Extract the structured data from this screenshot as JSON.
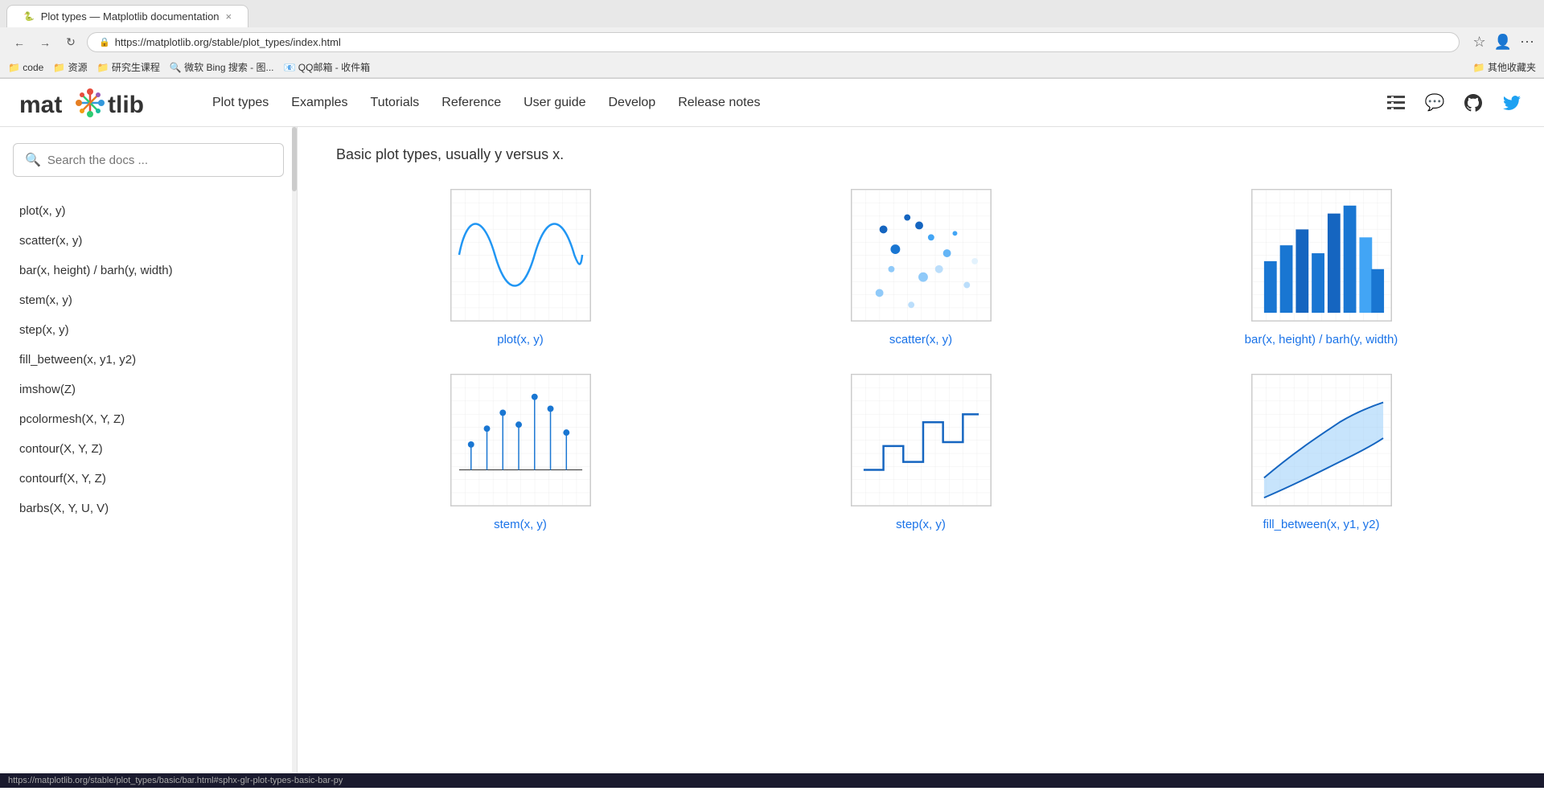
{
  "browser": {
    "url": "https://matplotlib.org/stable/plot_types/index.html",
    "bookmarks": [
      "code",
      "资源",
      "研究生课程",
      "微软 Bing 搜索 - 图...",
      "QQ邮箱 - 收件箱",
      "其他收藏夹"
    ]
  },
  "nav": {
    "logo_text_left": "mat",
    "logo_text_right": "tlib",
    "links": [
      "Plot types",
      "Examples",
      "Tutorials",
      "Reference",
      "User guide",
      "Develop",
      "Release notes"
    ]
  },
  "sidebar": {
    "search_placeholder": "Search the docs ...",
    "items": [
      "plot(x, y)",
      "scatter(x, y)",
      "bar(x, height) / barh(y, width)",
      "stem(x, y)",
      "step(x, y)",
      "fill_between(x, y1, y2)",
      "imshow(Z)",
      "pcolormesh(X, Y, Z)",
      "contour(X, Y, Z)",
      "contourf(X, Y, Z)",
      "barbs(X, Y, U, V)"
    ]
  },
  "content": {
    "intro": "Basic plot types, usually y versus x.",
    "plots": [
      {
        "label": "plot(x, y)",
        "type": "line"
      },
      {
        "label": "scatter(x, y)",
        "type": "scatter"
      },
      {
        "label": "bar(x, height) / barh(y,\nwidth)",
        "type": "bar"
      },
      {
        "label": "stem(x, y)",
        "type": "stem"
      },
      {
        "label": "step(x, y)",
        "type": "step"
      },
      {
        "label": "fill_between(x, y1, y2)",
        "type": "fill"
      }
    ]
  },
  "status_bar": {
    "url": "https://matplotlib.org/stable/plot_types/basic/bar.html#sphx-glr-plot-types-basic-bar-py"
  }
}
